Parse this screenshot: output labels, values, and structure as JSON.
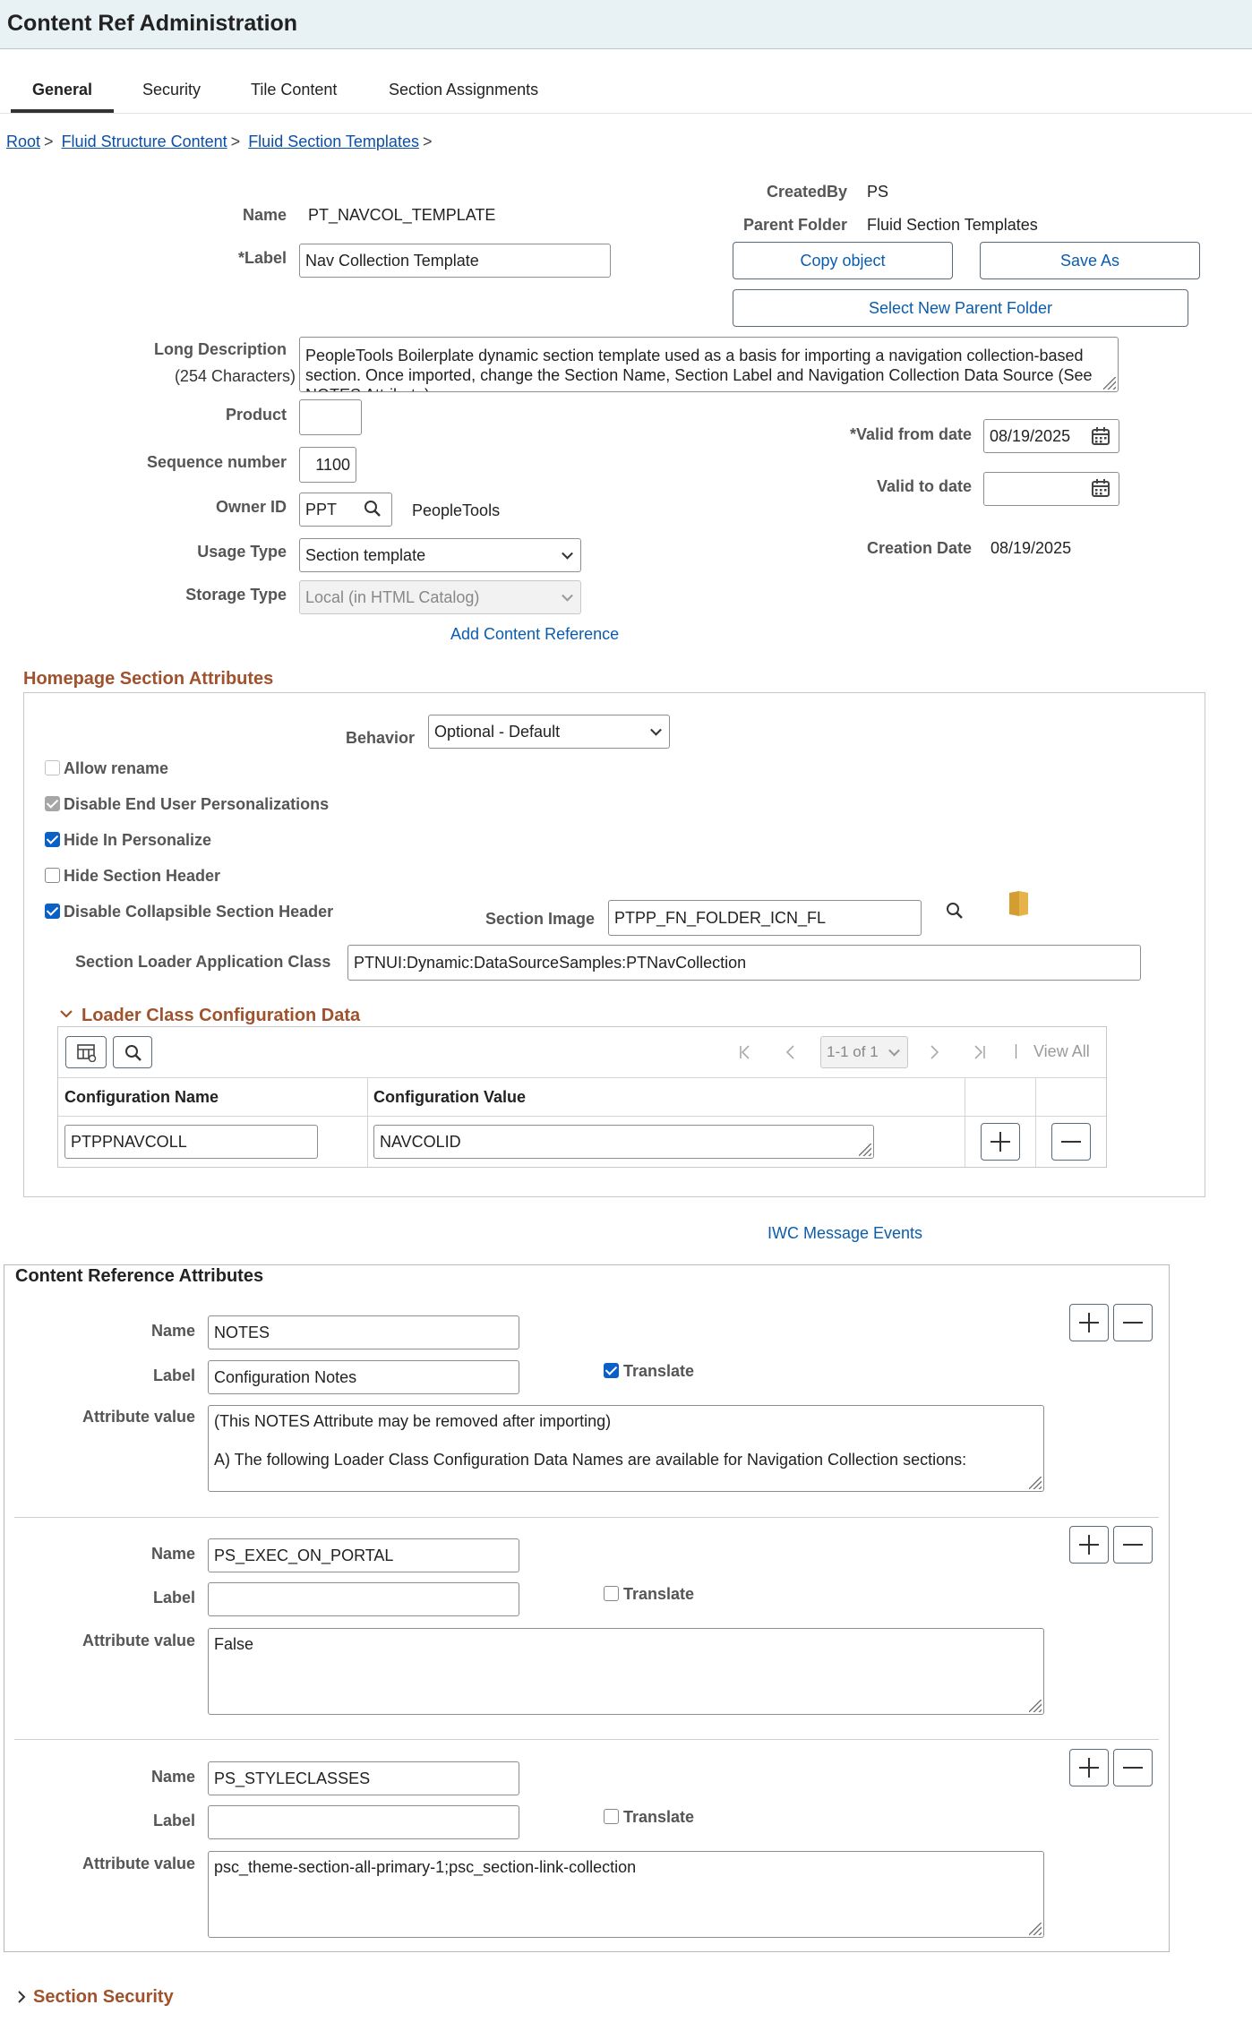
{
  "header": {
    "title": "Content Ref Administration"
  },
  "tabs": [
    "General",
    "Security",
    "Tile Content",
    "Section Assignments"
  ],
  "breadcrumb": {
    "items": [
      "Root",
      "Fluid Structure Content",
      "Fluid Section Templates"
    ],
    "sep": ">"
  },
  "general": {
    "name_label": "Name",
    "name_value": "PT_NAVCOL_TEMPLATE",
    "label_label": "*Label",
    "label_value": "Nav Collection Template",
    "createdby_label": "CreatedBy",
    "createdby_value": "PS",
    "parent_label": "Parent Folder",
    "parent_value": "Fluid Section Templates",
    "copy_button": "Copy object",
    "saveas_button": "Save As",
    "select_parent_button": "Select New Parent Folder",
    "longdesc_label": "Long Description",
    "longdesc_sublabel": "(254 Characters)",
    "longdesc_value": "PeopleTools Boilerplate dynamic section template used as a basis for importing a navigation collection-based section.  Once imported, change the Section Name, Section Label and Navigation Collection Data Source (See NOTES Attribute).",
    "product_label": "Product",
    "product_value": "",
    "seq_label": "Sequence number",
    "seq_value": "1100",
    "owner_label": "Owner ID",
    "owner_value": "PPT",
    "owner_desc": "PeopleTools",
    "usage_label": "Usage Type",
    "usage_value": "Section template",
    "storage_label": "Storage Type",
    "storage_value": "Local (in HTML Catalog)",
    "validfrom_label": "*Valid from date",
    "validfrom_value": "08/19/2025",
    "validto_label": "Valid to date",
    "validto_value": "",
    "creation_label": "Creation Date",
    "creation_value": "08/19/2025",
    "add_cref_link": "Add Content Reference"
  },
  "homepage": {
    "title": "Homepage Section Attributes",
    "behavior_label": "Behavior",
    "behavior_value": "Optional - Default",
    "allow_rename": "Allow rename",
    "disable_personalizations": "Disable End User Personalizations",
    "hide_personalize": "Hide In Personalize",
    "hide_header": "Hide Section Header",
    "disable_collapsible": "Disable Collapsible Section Header",
    "section_image_label": "Section Image",
    "section_image_value": "PTPP_FN_FOLDER_ICN_FL",
    "loader_class_label": "Section Loader Application Class",
    "loader_class_value": "PTNUI:Dynamic:DataSourceSamples:PTNavCollection",
    "loader_config": {
      "title": "Loader Class Configuration Data",
      "pager": "1-1 of 1",
      "view_all": "View All",
      "col_name": "Configuration Name",
      "col_value": "Configuration Value",
      "row_name": "PTPPNAVCOLL",
      "row_value": "NAVCOLID"
    }
  },
  "iwc_link": "IWC Message Events",
  "cref_attrs": {
    "title": "Content Reference Attributes",
    "name_label": "Name",
    "label_label": "Label",
    "value_label": "Attribute value",
    "translate_label": "Translate",
    "items": [
      {
        "name": "NOTES",
        "label": "Configuration Notes",
        "value1": "(This NOTES Attribute may be removed after importing)",
        "value2": "A) The following Loader Class Configuration Data Names are available for Navigation Collection sections:"
      },
      {
        "name": "PS_EXEC_ON_PORTAL",
        "label": "",
        "value1": "False",
        "value2": ""
      },
      {
        "name": "PS_STYLECLASSES",
        "label": "",
        "value1": "psc_theme-section-all-primary-1;psc_section-link-collection",
        "value2": ""
      }
    ]
  },
  "section_security": {
    "title": "Section Security"
  }
}
